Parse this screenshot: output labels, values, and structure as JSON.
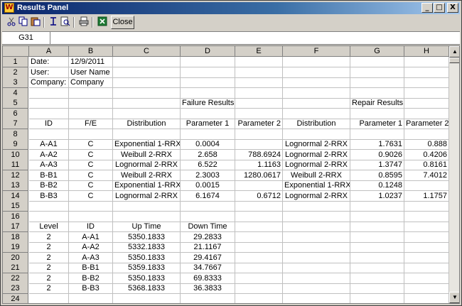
{
  "window": {
    "title": "Results Panel",
    "app_icon": "W"
  },
  "titlebar_buttons": {
    "minimize": "_",
    "maximize": "□",
    "close": "X"
  },
  "toolbar": {
    "icons": [
      "cut-icon",
      "copy-icon",
      "paste-icon",
      "print-setup-icon",
      "print-preview-icon",
      "print-icon",
      "excel-icon"
    ],
    "close_label": "Close"
  },
  "formula_bar": {
    "cell_ref": "G31",
    "value": ""
  },
  "columns": [
    "A",
    "B",
    "C",
    "D",
    "E",
    "F",
    "G",
    "H"
  ],
  "row_numbers": [
    "1",
    "2",
    "3",
    "4",
    "5",
    "6",
    "7",
    "8",
    "9",
    "10",
    "11",
    "12",
    "13",
    "14",
    "15",
    "16",
    "17",
    "18",
    "19",
    "20",
    "21",
    "22",
    "23",
    "24"
  ],
  "rows": [
    [
      "Date:",
      "12/9/2011",
      "",
      "",
      "",
      "",
      "",
      ""
    ],
    [
      "User:",
      "User Name",
      "",
      "",
      "",
      "",
      "",
      ""
    ],
    [
      "Company:",
      "Company",
      "",
      "",
      "",
      "",
      "",
      ""
    ],
    [
      "",
      "",
      "",
      "",
      "",
      "",
      "",
      ""
    ],
    [
      "",
      "",
      "",
      "Failure Results",
      "",
      "",
      "Repair Results",
      ""
    ],
    [
      "",
      "",
      "",
      "",
      "",
      "",
      "",
      ""
    ],
    [
      "ID",
      "F/E",
      "Distribution",
      "Parameter 1",
      "Parameter 2",
      "Distribution",
      "Parameter 1",
      "Parameter 2"
    ],
    [
      "",
      "",
      "",
      "",
      "",
      "",
      "",
      ""
    ],
    [
      "A-A1",
      "C",
      "Exponential 1-RRX",
      "0.0004",
      "",
      "Lognormal 2-RRX",
      "1.7631",
      "0.888"
    ],
    [
      "A-A2",
      "C",
      "Weibull 2-RRX",
      "2.658",
      "788.6924",
      "Lognormal 2-RRX",
      "0.9026",
      "0.4206"
    ],
    [
      "A-A3",
      "C",
      "Lognormal 2-RRX",
      "6.522",
      "1.1163",
      "Lognormal 2-RRX",
      "1.3747",
      "0.8161"
    ],
    [
      "B-B1",
      "C",
      "Weibull 2-RRX",
      "2.3003",
      "1280.0617",
      "Weibull 2-RRX",
      "0.8595",
      "7.4012"
    ],
    [
      "B-B2",
      "C",
      "Exponential 1-RRX",
      "0.0015",
      "",
      "Exponential 1-RRX",
      "0.1248",
      ""
    ],
    [
      "B-B3",
      "C",
      "Lognormal 2-RRX",
      "6.1674",
      "0.6712",
      "Lognormal 2-RRX",
      "1.0237",
      "1.1757"
    ],
    [
      "",
      "",
      "",
      "",
      "",
      "",
      "",
      ""
    ],
    [
      "",
      "",
      "",
      "",
      "",
      "",
      "",
      ""
    ],
    [
      "Level",
      "ID",
      "Up Time",
      "Down Time",
      "",
      "",
      "",
      ""
    ],
    [
      "2",
      "A-A1",
      "5350.1833",
      "29.2833",
      "",
      "",
      "",
      ""
    ],
    [
      "2",
      "A-A2",
      "5332.1833",
      "21.1167",
      "",
      "",
      "",
      ""
    ],
    [
      "2",
      "A-A3",
      "5350.1833",
      "29.4167",
      "",
      "",
      "",
      ""
    ],
    [
      "2",
      "B-B1",
      "5359.1833",
      "34.7667",
      "",
      "",
      "",
      ""
    ],
    [
      "2",
      "B-B2",
      "5350.1833",
      "69.8333",
      "",
      "",
      "",
      ""
    ],
    [
      "2",
      "B-B3",
      "5368.1833",
      "36.3833",
      "",
      "",
      "",
      ""
    ],
    [
      "",
      "",
      "",
      "",
      "",
      "",
      "",
      ""
    ]
  ],
  "scrollbar": {
    "up": "▲",
    "down": "▼"
  }
}
